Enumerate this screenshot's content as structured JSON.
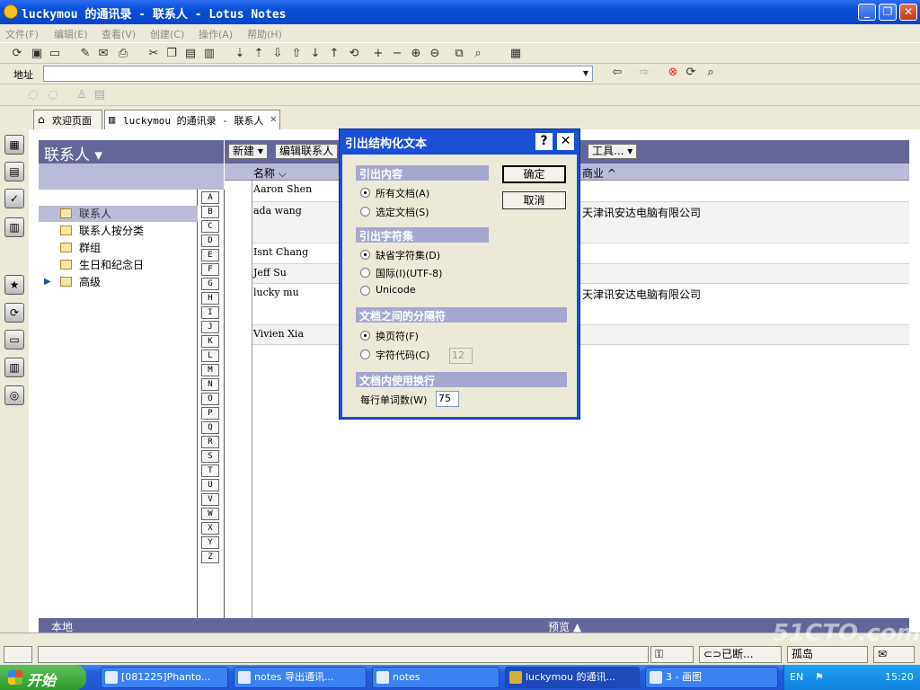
{
  "window": {
    "title": "luckymou 的通讯录 - 联系人 - Lotus Notes"
  },
  "menu": [
    "文件(F)",
    "编辑(E)",
    "查看(V)",
    "创建(C)",
    "操作(A)",
    "帮助(H)"
  ],
  "address_bar": {
    "label": "地址",
    "value": ""
  },
  "tabs": [
    {
      "label": "欢迎页面",
      "icon": "home-icon"
    },
    {
      "label": "luckymou 的通讯录 - 联系人",
      "icon": "address-book-icon"
    }
  ],
  "left_pane": {
    "title": "联系人 ▾",
    "items": [
      {
        "label": "联系人",
        "selected": true
      },
      {
        "label": "联系人按分类",
        "selected": false
      },
      {
        "label": "群组",
        "selected": false
      },
      {
        "label": "生日和纪念日",
        "selected": false
      },
      {
        "label": "高级",
        "selected": false,
        "folder": true
      }
    ],
    "status": "本地"
  },
  "letters": [
    "A",
    "B",
    "C",
    "D",
    "E",
    "F",
    "G",
    "H",
    "I",
    "J",
    "K",
    "L",
    "M",
    "N",
    "O",
    "P",
    "Q",
    "R",
    "S",
    "T",
    "U",
    "V",
    "W",
    "X",
    "Y",
    "Z"
  ],
  "action_bar": {
    "new": "新建 ▾",
    "edit": "编辑联系人",
    "tools": "工具... ▾"
  },
  "columns": {
    "name": "名称 ⌵",
    "business": "商业 ^"
  },
  "contacts": [
    {
      "name": "Aaron Shen",
      "company": ""
    },
    {
      "name": "ada wang",
      "company": "天津讯安达电脑有限公司"
    },
    {
      "name": "Isnt Chang",
      "company": ""
    },
    {
      "name": "Jeff Su",
      "company": ""
    },
    {
      "name": "lucky mu",
      "company": "天津讯安达电脑有限公司"
    },
    {
      "name": "Vivien Xia",
      "company": ""
    }
  ],
  "preview": "预览 ▲",
  "dialog": {
    "title": "引出结构化文本",
    "ok": "确定",
    "cancel": "取消",
    "section_content": "引出内容",
    "opt_all_docs": "所有文档(A)",
    "opt_selected_docs": "选定文档(S)",
    "section_charset": "引出字符集",
    "opt_default_charset": "缺省字符集(D)",
    "opt_utf8": "国际(I)(UTF-8)",
    "opt_unicode": "Unicode",
    "section_separator": "文档之间的分隔符",
    "opt_page_break": "换页符(F)",
    "opt_char_code": "字符代码(C)",
    "char_code_value": "12",
    "section_wrap": "文档内使用换行",
    "words_per_line_label": "每行单词数(W)",
    "words_per_line_value": "75"
  },
  "statusbar": {
    "offline": "⊂⊃已断...",
    "isolated": "孤岛"
  },
  "taskbar": {
    "start": "开始",
    "tasks": [
      "[081225]Phanto...",
      "notes 导出通讯...",
      "notes",
      "luckymou 的通讯...",
      "3 - 画图"
    ],
    "lang": "EN",
    "time": "15:20"
  },
  "watermark": "51CTO.com"
}
